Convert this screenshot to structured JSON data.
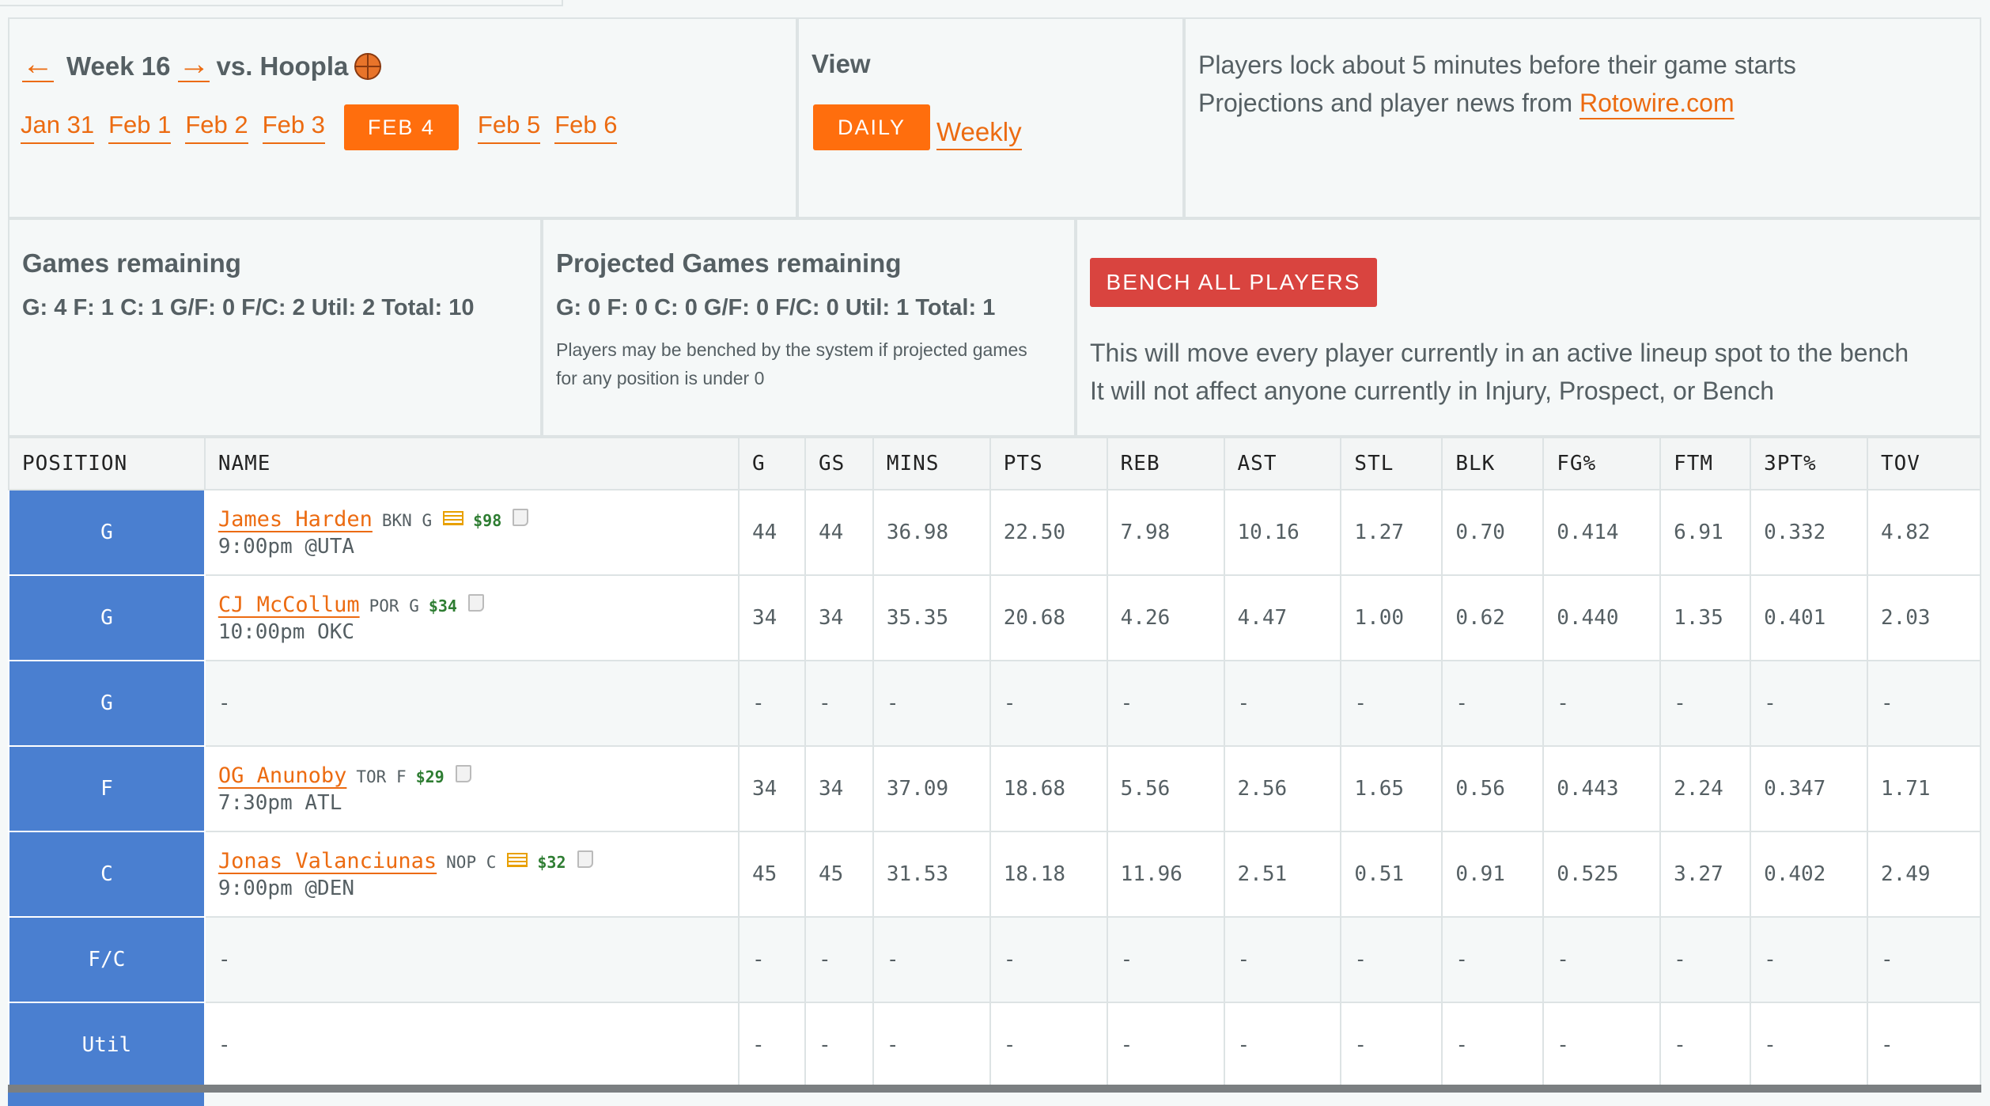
{
  "header": {
    "week_label": "Week 16",
    "opponent": "vs. Hoopla",
    "prev_arrow": "←",
    "next_arrow": "→",
    "dates": [
      "Jan 31",
      "Feb 1",
      "Feb 2",
      "Feb 3",
      "FEB 4",
      "Feb 5",
      "Feb 6"
    ],
    "active_date_index": 4
  },
  "view": {
    "title": "View",
    "daily_label": "DAILY",
    "weekly_label": "Weekly"
  },
  "info": {
    "lock_text": "Players lock about 5 minutes before their game starts",
    "source_prefix": "Projections and player news from ",
    "source_link": "Rotowire.com"
  },
  "games_remaining": {
    "title": "Games remaining",
    "line": "G: 4 F: 1 C: 1 G/F: 0 F/C: 2 Util: 2 Total: 10"
  },
  "projected": {
    "title": "Projected Games remaining",
    "line": "G: 0 F: 0 C: 0 G/F: 0 F/C: 0 Util: 1 Total: 1",
    "note": "Players may be benched by the system if projected games for any position is under 0"
  },
  "bench": {
    "button_label": "BENCH ALL PLAYERS",
    "line1": "This will move every player currently in an active lineup spot to the bench",
    "line2": "It will not affect anyone currently in Injury, Prospect, or Bench"
  },
  "table": {
    "columns": [
      "POSITION",
      "NAME",
      "G",
      "GS",
      "MINS",
      "PTS",
      "REB",
      "AST",
      "STL",
      "BLK",
      "FG%",
      "FTM",
      "3PT%",
      "TOV"
    ],
    "rows": [
      {
        "pos": "G",
        "name": "James Harden",
        "team": "BKN G",
        "salary": "$98",
        "news": true,
        "time": "9:00pm @UTA",
        "stats": [
          "44",
          "44",
          "36.98",
          "22.50",
          "7.98",
          "10.16",
          "1.27",
          "0.70",
          "0.414",
          "6.91",
          "0.332",
          "4.82"
        ]
      },
      {
        "pos": "G",
        "name": "CJ McCollum",
        "team": "POR G",
        "salary": "$34",
        "news": false,
        "time": "10:00pm OKC",
        "stats": [
          "34",
          "34",
          "35.35",
          "20.68",
          "4.26",
          "4.47",
          "1.00",
          "0.62",
          "0.440",
          "1.35",
          "0.401",
          "2.03"
        ]
      },
      {
        "pos": "G",
        "name": "",
        "team": "",
        "salary": "",
        "news": false,
        "time": "",
        "empty": "-",
        "stats": [
          "-",
          "-",
          "-",
          "-",
          "-",
          "-",
          "-",
          "-",
          "-",
          "-",
          "-",
          "-"
        ]
      },
      {
        "pos": "F",
        "name": "OG Anunoby",
        "team": "TOR F",
        "salary": "$29",
        "news": false,
        "time": "7:30pm ATL",
        "stats": [
          "34",
          "34",
          "37.09",
          "18.68",
          "5.56",
          "2.56",
          "1.65",
          "0.56",
          "0.443",
          "2.24",
          "0.347",
          "1.71"
        ]
      },
      {
        "pos": "C",
        "name": "Jonas Valanciunas",
        "team": "NOP C",
        "salary": "$32",
        "news": true,
        "time": "9:00pm @DEN",
        "stats": [
          "45",
          "45",
          "31.53",
          "18.18",
          "11.96",
          "2.51",
          "0.51",
          "0.91",
          "0.525",
          "3.27",
          "0.402",
          "2.49"
        ]
      },
      {
        "pos": "F/C",
        "name": "",
        "team": "",
        "salary": "",
        "news": false,
        "time": "",
        "empty": "-",
        "stats": [
          "-",
          "-",
          "-",
          "-",
          "-",
          "-",
          "-",
          "-",
          "-",
          "-",
          "-",
          "-"
        ]
      },
      {
        "pos": "Util",
        "name": "",
        "team": "",
        "salary": "",
        "news": false,
        "time": "",
        "empty": "-",
        "stats": [
          "-",
          "-",
          "-",
          "-",
          "-",
          "-",
          "-",
          "-",
          "-",
          "-",
          "-",
          "-"
        ]
      }
    ]
  },
  "colors": {
    "accent": "#ff6e0d",
    "danger": "#d9443f",
    "position_bg": "#4a7fd0",
    "salary": "#2e7d32"
  }
}
